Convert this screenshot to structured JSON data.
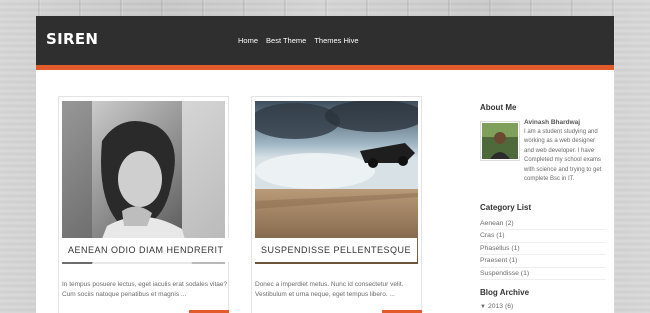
{
  "site": {
    "logo": "SIREN"
  },
  "nav": {
    "items": [
      {
        "label": "Home"
      },
      {
        "label": "Best Theme"
      },
      {
        "label": "Themes Hive"
      }
    ]
  },
  "posts": [
    {
      "title": "AENEAN ODIO DIAM HENDRERIT",
      "excerpt": "In tempus posuere lectus, eget iaculis erat sodales vitae? Cum sociis natoque penatibus et magnis ..."
    },
    {
      "title": "SUSPENDISSE PELLENTESQUE",
      "excerpt": "Donec a imperdiet metus. Nunc id consectetur velit. Vestibulum et urna neque, eget tempus libero. ..."
    }
  ],
  "sidebar": {
    "about": {
      "title": "About Me",
      "name": "Avinash Bhardwaj",
      "bio": "I am a student studying and working as a web designer and web developer. I have Completed my school exams with science and trying to get complete Bsc in IT."
    },
    "categories": {
      "title": "Category List",
      "items": [
        {
          "label": "Aenean (2)"
        },
        {
          "label": "Cras (1)"
        },
        {
          "label": "Phasellus (1)"
        },
        {
          "label": "Praesent (1)"
        },
        {
          "label": "Suspendisse (1)"
        }
      ]
    },
    "archive": {
      "title": "Blog Archive",
      "items": [
        {
          "label": "2013 (6)"
        }
      ]
    }
  },
  "colors": {
    "accent": "#e35a2b",
    "header_bg": "#2f2f2f"
  }
}
